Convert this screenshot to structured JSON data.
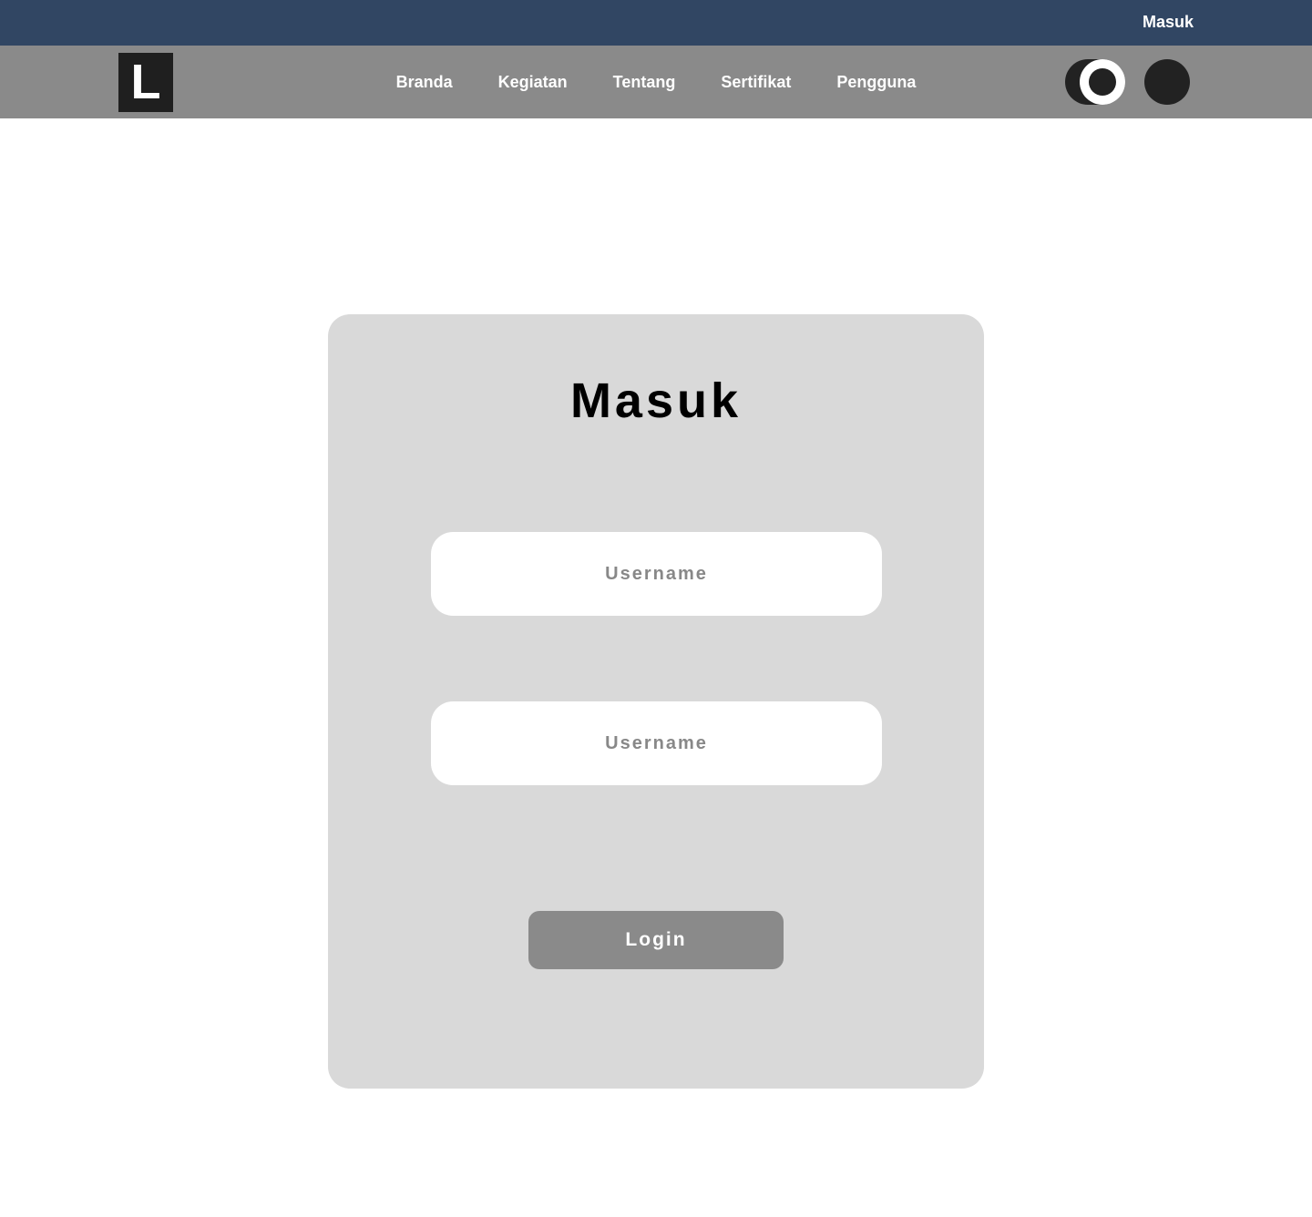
{
  "topbar": {
    "login_link": "Masuk",
    "background_color": "#314663"
  },
  "navbar": {
    "logo_letter": "L",
    "items": [
      {
        "label": "Branda"
      },
      {
        "label": "Kegiatan"
      },
      {
        "label": "Tentang"
      },
      {
        "label": "Sertifikat"
      },
      {
        "label": "Pengguna"
      }
    ],
    "background_color": "#8a8a8a",
    "theme_toggle_icon": "toggle-icon",
    "avatar_icon": "avatar-icon"
  },
  "login_card": {
    "title": "Masuk",
    "username_placeholder": "Username",
    "password_placeholder": "Username",
    "login_button": "Login",
    "card_color": "#d9d9d9",
    "button_color": "#8a8a8a"
  }
}
